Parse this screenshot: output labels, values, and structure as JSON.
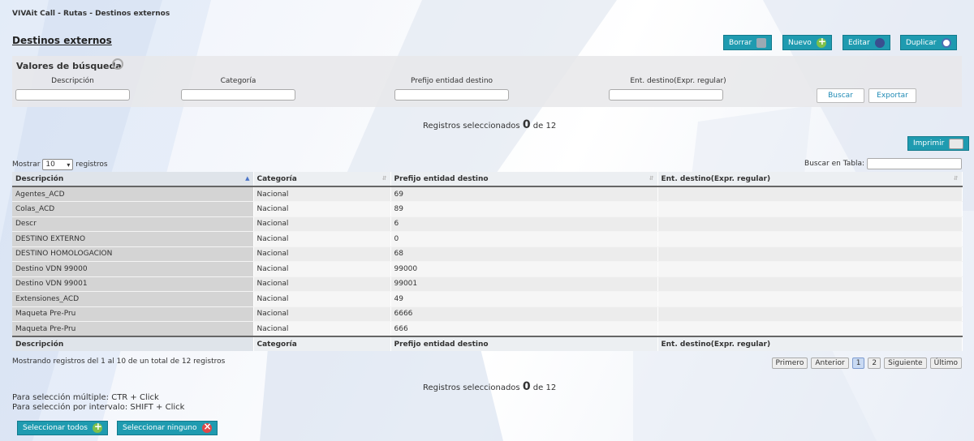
{
  "app": {
    "title": "VIVAit Call - Rutas - Destinos externos"
  },
  "page": {
    "title": "Destinos externos"
  },
  "toolbar": {
    "borrar": "Borrar",
    "nuevo": "Nuevo",
    "editar": "Editar",
    "duplicar": "Duplicar"
  },
  "search": {
    "title": "Valores de búsqueda",
    "fields": [
      {
        "label": "Descripción",
        "value": ""
      },
      {
        "label": "Categoría",
        "value": ""
      },
      {
        "label": "Prefijo entidad destino",
        "value": ""
      },
      {
        "label": "Ent. destino(Expr. regular)",
        "value": ""
      }
    ],
    "buscar": "Buscar",
    "exportar": "Exportar"
  },
  "selection_top": {
    "prefix": "Registros seleccionados",
    "count": "0",
    "of": "de",
    "total": "12"
  },
  "print_label": "Imprimir",
  "table_controls": {
    "mostrar": "Mostrar",
    "page_size": "10",
    "registros": "registros",
    "buscar_en_tabla": "Buscar en Tabla:",
    "search_value": ""
  },
  "table": {
    "headers": [
      "Descripción",
      "Categoría",
      "Prefijo entidad destino",
      "Ent. destino(Expr. regular)"
    ],
    "rows": [
      [
        "Agentes_ACD",
        "Nacional",
        "69",
        ""
      ],
      [
        "Colas_ACD",
        "Nacional",
        "89",
        ""
      ],
      [
        "Descr",
        "Nacional",
        "6",
        ""
      ],
      [
        "DESTINO EXTERNO",
        "Nacional",
        "0",
        ""
      ],
      [
        "DESTINO HOMOLOGACION",
        "Nacional",
        "68",
        ""
      ],
      [
        "Destino VDN 99000",
        "Nacional",
        "99000",
        ""
      ],
      [
        "Destino VDN 99001",
        "Nacional",
        "99001",
        ""
      ],
      [
        "Extensiones_ACD",
        "Nacional",
        "49",
        ""
      ],
      [
        "Maqueta Pre-Pru",
        "Nacional",
        "6666",
        ""
      ],
      [
        "Maqueta Pre-Pru",
        "Nacional",
        "666",
        ""
      ]
    ]
  },
  "table_info": "Mostrando registros del 1 al 10 de un total de 12 registros",
  "pager": {
    "first": "Primero",
    "prev": "Anterior",
    "pages": [
      "1",
      "2"
    ],
    "next": "Siguiente",
    "last": "Último"
  },
  "selection_bottom": {
    "prefix": "Registros seleccionados",
    "count": "0",
    "of": "de",
    "total": "12"
  },
  "help": {
    "multi": "Para selección múltiple: CTR + Click",
    "interval": "Para selección por intervalo: SHIFT + Click"
  },
  "bottom_buttons": {
    "select_all": "Seleccionar todos",
    "select_none": "Seleccionar ninguno"
  }
}
